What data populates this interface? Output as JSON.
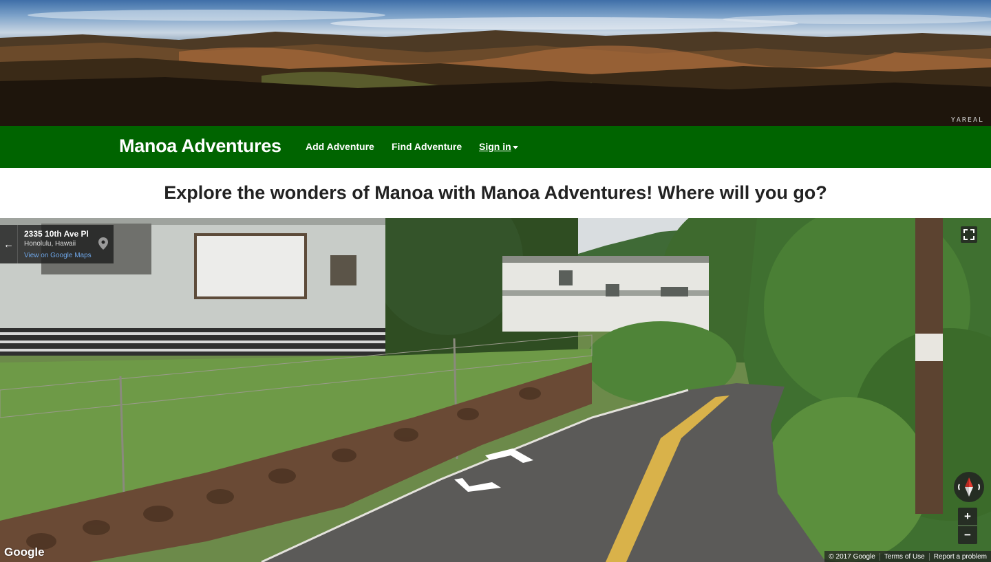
{
  "hero": {
    "watermark": "YAREAL"
  },
  "navbar": {
    "brand": "Manoa Adventures",
    "links": [
      {
        "label": "Add Adventure"
      },
      {
        "label": "Find Adventure"
      },
      {
        "label": "Sign in"
      }
    ]
  },
  "tagline": "Explore the wonders of Manoa with Manoa Adventures! Where will you go?",
  "streetview": {
    "address_line1": "2335 10th Ave Pl",
    "address_line2": "Honolulu, Hawaii",
    "map_link": "View on Google Maps",
    "zoom_in": "+",
    "zoom_out": "−",
    "logo": "Google",
    "footer": {
      "copyright": "© 2017 Google",
      "terms": "Terms of Use",
      "report": "Report a problem"
    }
  },
  "colors": {
    "navbar": "#006400",
    "tagline_text": "#222222",
    "map_link": "#6ea6e8"
  }
}
